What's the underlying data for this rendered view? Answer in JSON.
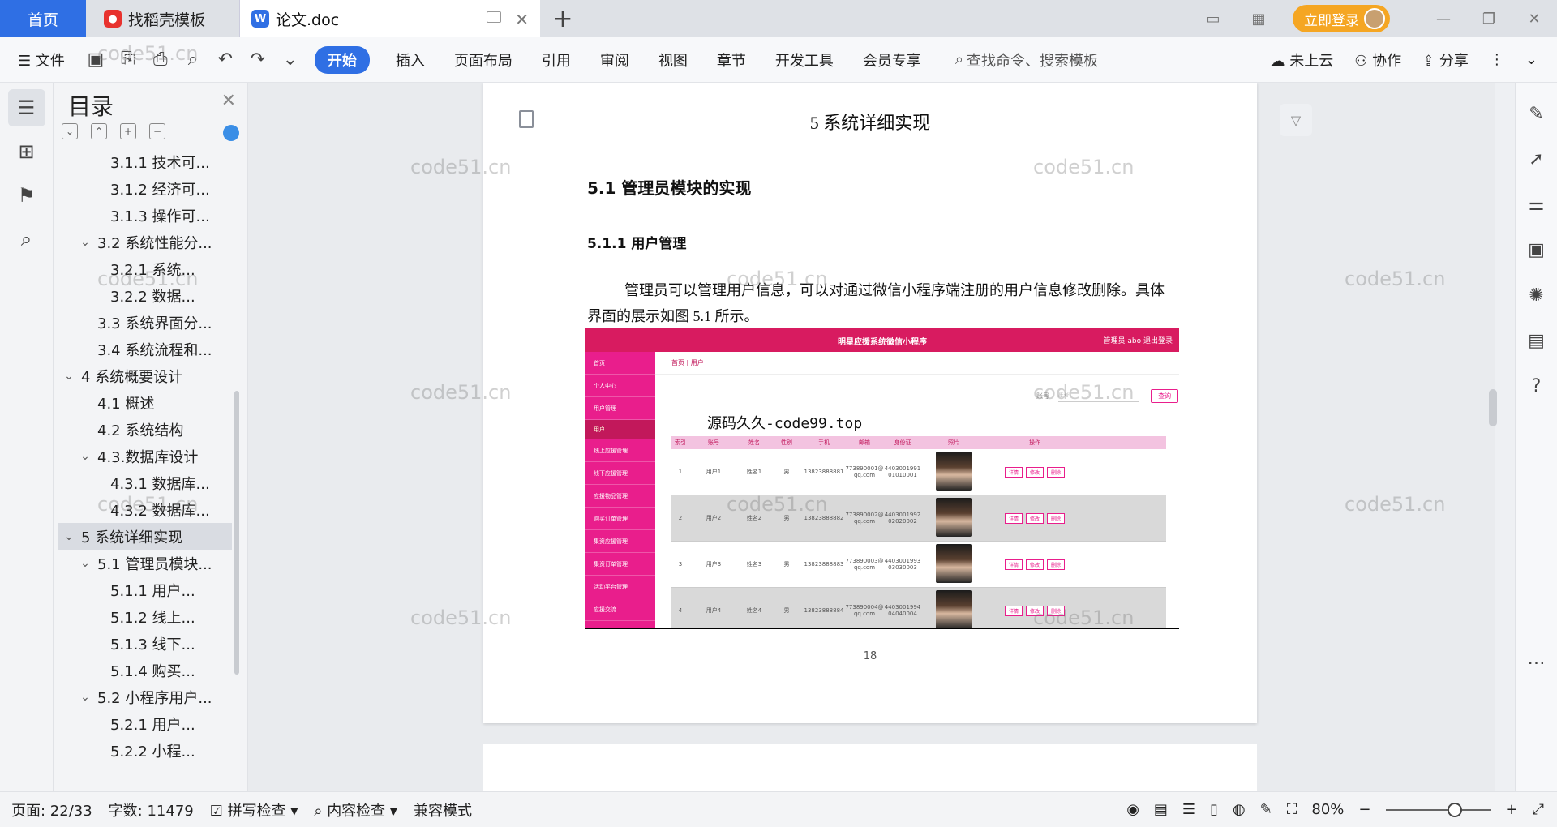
{
  "tabs": {
    "home": "首页",
    "templates": "找稻壳模板",
    "doc": "论文.doc",
    "new_tab": "+"
  },
  "titlebar": {
    "login": "立即登录"
  },
  "ribbon": {
    "file": "文件",
    "items": [
      "开始",
      "插入",
      "页面布局",
      "引用",
      "审阅",
      "视图",
      "章节",
      "开发工具",
      "会员专享"
    ],
    "search_placeholder": "查找命令、搜索模板",
    "cloud": "未上云",
    "collab": "协作",
    "share": "分享"
  },
  "toc": {
    "title": "目录",
    "items": [
      {
        "label": "3.1.1 技术可...",
        "level": 3
      },
      {
        "label": "3.1.2 经济可...",
        "level": 3
      },
      {
        "label": "3.1.3 操作可...",
        "level": 3
      },
      {
        "label": "3.2 系统性能分...",
        "level": 2,
        "expanded": true
      },
      {
        "label": "3.2.1  系统...",
        "level": 3
      },
      {
        "label": "3.2.2  数据...",
        "level": 3
      },
      {
        "label": "3.3 系统界面分...",
        "level": 2
      },
      {
        "label": "3.4 系统流程和...",
        "level": 2
      },
      {
        "label": "4 系统概要设计",
        "level": 1,
        "expanded": true
      },
      {
        "label": "4.1 概述",
        "level": 2
      },
      {
        "label": "4.2 系统结构",
        "level": 2
      },
      {
        "label": "4.3.数据库设计",
        "level": 2,
        "expanded": true
      },
      {
        "label": "4.3.1 数据库...",
        "level": 3
      },
      {
        "label": "4.3.2 数据库...",
        "level": 3
      },
      {
        "label": "5 系统详细实现",
        "level": 1,
        "expanded": true,
        "selected": true
      },
      {
        "label": "5.1  管理员模块...",
        "level": 2,
        "expanded": true
      },
      {
        "label": "5.1.1  用户...",
        "level": 3
      },
      {
        "label": "5.1.2  线上...",
        "level": 3
      },
      {
        "label": "5.1.3  线下...",
        "level": 3
      },
      {
        "label": "5.1.4  购买...",
        "level": 3
      },
      {
        "label": "5.2  小程序用户...",
        "level": 2,
        "expanded": true
      },
      {
        "label": "5.2.1  用户...",
        "level": 3
      },
      {
        "label": "5.2.2  小程...",
        "level": 3
      }
    ]
  },
  "document": {
    "h1": "5 系统详细实现",
    "h2": "5.1  管理员模块的实现",
    "h3": "5.1.1  用户管理",
    "paragraph": "管理员可以管理用户信息，可以对通过微信小程序端注册的用户信息修改删除。具体界面的展示如图 5.1 所示。",
    "page_number": "18",
    "screenshot": {
      "app_title": "明星应援系统微信小程序",
      "user_info": "管理员 abo   退出登录",
      "breadcrumb": "首页  |  用户",
      "search_label": "账号",
      "search_placeholder": "账号",
      "search_button": "查询",
      "overlay_watermark": "源码久久-code99.top",
      "menu": [
        "首页",
        "个人中心",
        "用户管理",
        "用户",
        "线上应援管理",
        "线下应援管理",
        "应援物品管理",
        "购买订单管理",
        "集资应援管理",
        "集资订单管理",
        "活动平台管理",
        "应援交流"
      ],
      "columns": [
        "索引",
        "账号",
        "姓名",
        "性别",
        "手机",
        "邮箱",
        "身份证",
        "照片",
        "操作"
      ],
      "rows": [
        [
          "1",
          "用户1",
          "姓名1",
          "男",
          "13823888881",
          "773890001@qq.com",
          "440300199101010001"
        ],
        [
          "2",
          "用户2",
          "姓名2",
          "男",
          "13823888882",
          "773890002@qq.com",
          "440300199202020002"
        ],
        [
          "3",
          "用户3",
          "姓名3",
          "男",
          "13823888883",
          "773890003@qq.com",
          "440300199303030003"
        ],
        [
          "4",
          "用户4",
          "姓名4",
          "男",
          "13823888884",
          "773890004@qq.com",
          "440300199404040004"
        ]
      ],
      "ops": [
        "详情",
        "修改",
        "删除"
      ]
    }
  },
  "status": {
    "page": "页面: 22/33",
    "words": "字数: 11479",
    "spell": "拼写检查",
    "content": "内容检查",
    "compat": "兼容模式",
    "zoom": "80%"
  },
  "watermark": "code51.cn"
}
